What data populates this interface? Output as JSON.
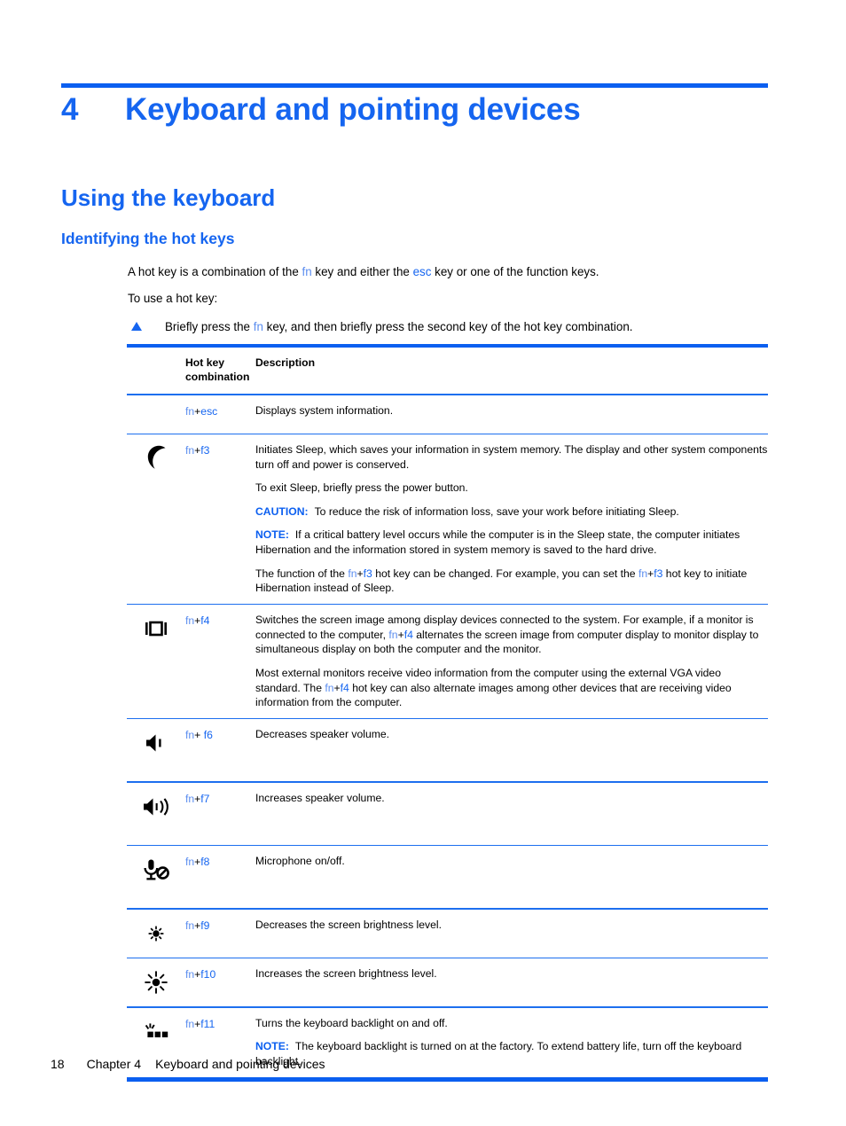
{
  "chapter": {
    "number": "4",
    "title": "Keyboard and pointing devices"
  },
  "headings": {
    "h1": "Using the keyboard",
    "h2": "Identifying the hot keys"
  },
  "intro": {
    "line1_a": "A hot key is a combination of the ",
    "line1_fn": "fn",
    "line1_b": " key and either the ",
    "line1_esc": "esc",
    "line1_c": " key or one of the function keys.",
    "line2": "To use a hot key:",
    "bullet_a": "Briefly press the ",
    "bullet_fn": "fn",
    "bullet_b": " key, and then briefly press the second key of the hot key combination."
  },
  "table": {
    "header": {
      "col_icon": "",
      "col_key_line1": "Hot key",
      "col_key_line2": "combination",
      "col_desc": "Description"
    },
    "rows": [
      {
        "icon": "none",
        "key_fn": "fn",
        "key_plus": "+",
        "key_rest": "esc",
        "desc": [
          {
            "text": "Displays system information."
          }
        ]
      },
      {
        "icon": "moon-icon",
        "key_fn": "fn",
        "key_plus": "+",
        "key_rest": "f3",
        "desc": [
          {
            "text": "Initiates Sleep, which saves your information in system memory. The display and other system components turn off and power is conserved."
          },
          {
            "text": "To exit Sleep, briefly press the power button."
          },
          {
            "label": "CAUTION:",
            "text": "To reduce the risk of information loss, save your work before initiating Sleep."
          },
          {
            "label": "NOTE:",
            "text": "If a critical battery level occurs while the computer is in the Sleep state, the computer initiates Hibernation and the information stored in system memory is saved to the hard drive."
          },
          {
            "text_a": "The function of the ",
            "kfn": "fn",
            "kplus": "+",
            "krest": "f3",
            "text_b": " hot key can be changed. For example, you can set the ",
            "kfn2": "fn",
            "kplus2": "+",
            "krest2": "f3",
            "text_c": " hot key to initiate Hibernation instead of Sleep."
          }
        ]
      },
      {
        "icon": "display-switch-icon",
        "key_fn": "fn",
        "key_plus": "+",
        "key_rest": "f4",
        "desc": [
          {
            "text_a": "Switches the screen image among display devices connected to the system. For example, if a monitor is connected to the computer, ",
            "kfn": "fn",
            "kplus": "+",
            "krest": "f4",
            "text_b": " alternates the screen image from computer display to monitor display to simultaneous display on both the computer and the monitor."
          },
          {
            "text_a": "Most external monitors receive video information from the computer using the external VGA video standard. The ",
            "kfn": "fn",
            "kplus": "+",
            "krest": "f4",
            "text_b": " hot key can also alternate images among other devices that are receiving video information from the computer."
          }
        ]
      },
      {
        "icon": "volume-down-icon",
        "key_fn": "fn",
        "key_plus": "+ ",
        "key_rest": "f6",
        "desc": [
          {
            "text": "Decreases speaker volume."
          }
        ]
      },
      {
        "icon": "volume-up-icon",
        "key_fn": "fn",
        "key_plus": "+",
        "key_rest": "f7",
        "desc": [
          {
            "text": "Increases speaker volume."
          }
        ]
      },
      {
        "icon": "microphone-mute-icon",
        "key_fn": "fn",
        "key_plus": "+",
        "key_rest": "f8",
        "desc": [
          {
            "text": "Microphone on/off."
          }
        ]
      },
      {
        "icon": "brightness-down-icon",
        "key_fn": "fn",
        "key_plus": "+",
        "key_rest": "f9",
        "desc": [
          {
            "text": "Decreases the screen brightness level."
          }
        ]
      },
      {
        "icon": "brightness-up-icon",
        "key_fn": "fn",
        "key_plus": "+",
        "key_rest": "f10",
        "desc": [
          {
            "text": "Increases the screen brightness level."
          }
        ]
      },
      {
        "icon": "keyboard-backlight-icon",
        "key_fn": "fn",
        "key_plus": "+",
        "key_rest": "f11",
        "desc": [
          {
            "text": "Turns the keyboard backlight on and off."
          },
          {
            "label": "NOTE:",
            "text": "The keyboard backlight is turned on at the factory. To extend battery life, turn off the keyboard backlight."
          }
        ]
      }
    ]
  },
  "footer": {
    "page_number": "18",
    "chapter_label": "Chapter 4",
    "chapter_title": "Keyboard and pointing devices"
  },
  "colors": {
    "accent_blue": "#0b5ff0",
    "heading_blue": "#1565f0",
    "key_link_blue": "#5b8def"
  }
}
